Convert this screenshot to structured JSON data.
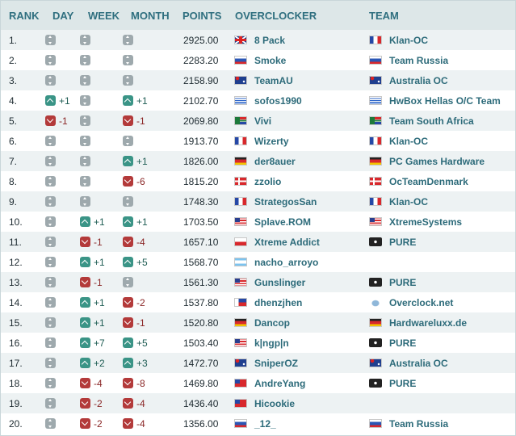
{
  "header": {
    "rank": "RANK",
    "day": "DAY",
    "week": "WEEK",
    "month": "MONTH",
    "points": "POINTS",
    "overclocker": "OVERCLOCKER",
    "team": "TEAM"
  },
  "rows": [
    {
      "rank": "1.",
      "day": {
        "dir": "same",
        "text": ""
      },
      "week": {
        "dir": "same",
        "text": ""
      },
      "month": {
        "dir": "same",
        "text": ""
      },
      "points": "2925.00",
      "overclocker": "8 Pack",
      "oc_flag": "uk",
      "team": "Klan-OC",
      "team_flag": "fr"
    },
    {
      "rank": "2.",
      "day": {
        "dir": "same",
        "text": ""
      },
      "week": {
        "dir": "same",
        "text": ""
      },
      "month": {
        "dir": "same",
        "text": ""
      },
      "points": "2283.20",
      "overclocker": "Smoke",
      "oc_flag": "ru",
      "team": "Team Russia",
      "team_flag": "ru"
    },
    {
      "rank": "3.",
      "day": {
        "dir": "same",
        "text": ""
      },
      "week": {
        "dir": "same",
        "text": ""
      },
      "month": {
        "dir": "same",
        "text": ""
      },
      "points": "2158.90",
      "overclocker": "TeamAU",
      "oc_flag": "au",
      "team": "Australia OC",
      "team_flag": "au"
    },
    {
      "rank": "4.",
      "day": {
        "dir": "up",
        "text": "+1"
      },
      "week": {
        "dir": "same",
        "text": ""
      },
      "month": {
        "dir": "up",
        "text": "+1"
      },
      "points": "2102.70",
      "overclocker": "sofos1990",
      "oc_flag": "gr",
      "team": "HwBox Hellas O/C Team",
      "team_flag": "gr"
    },
    {
      "rank": "5.",
      "day": {
        "dir": "down",
        "text": "-1"
      },
      "week": {
        "dir": "same",
        "text": ""
      },
      "month": {
        "dir": "down",
        "text": "-1"
      },
      "points": "2069.80",
      "overclocker": "Vivi",
      "oc_flag": "za",
      "team": "Team South Africa",
      "team_flag": "za"
    },
    {
      "rank": "6.",
      "day": {
        "dir": "same",
        "text": ""
      },
      "week": {
        "dir": "same",
        "text": ""
      },
      "month": {
        "dir": "same",
        "text": ""
      },
      "points": "1913.70",
      "overclocker": "Wizerty",
      "oc_flag": "fr",
      "team": "Klan-OC",
      "team_flag": "fr"
    },
    {
      "rank": "7.",
      "day": {
        "dir": "same",
        "text": ""
      },
      "week": {
        "dir": "same",
        "text": ""
      },
      "month": {
        "dir": "up",
        "text": "+1"
      },
      "points": "1826.00",
      "overclocker": "der8auer",
      "oc_flag": "de",
      "team": "PC Games Hardware",
      "team_flag": "de"
    },
    {
      "rank": "8.",
      "day": {
        "dir": "same",
        "text": ""
      },
      "week": {
        "dir": "same",
        "text": ""
      },
      "month": {
        "dir": "down",
        "text": "-6"
      },
      "points": "1815.20",
      "overclocker": "zzolio",
      "oc_flag": "dk",
      "team": "OcTeamDenmark",
      "team_flag": "dk"
    },
    {
      "rank": "9.",
      "day": {
        "dir": "same",
        "text": ""
      },
      "week": {
        "dir": "same",
        "text": ""
      },
      "month": {
        "dir": "same",
        "text": ""
      },
      "points": "1748.30",
      "overclocker": "StrategosSan",
      "oc_flag": "fr",
      "team": "Klan-OC",
      "team_flag": "fr"
    },
    {
      "rank": "10.",
      "day": {
        "dir": "same",
        "text": ""
      },
      "week": {
        "dir": "up",
        "text": "+1"
      },
      "month": {
        "dir": "up",
        "text": "+1"
      },
      "points": "1703.50",
      "overclocker": "Splave.ROM",
      "oc_flag": "us",
      "team": "XtremeSystems",
      "team_flag": "us"
    },
    {
      "rank": "11.",
      "day": {
        "dir": "same",
        "text": ""
      },
      "week": {
        "dir": "down",
        "text": "-1"
      },
      "month": {
        "dir": "down",
        "text": "-4"
      },
      "points": "1657.10",
      "overclocker": "Xtreme Addict",
      "oc_flag": "pl",
      "team": "PURE",
      "team_flag": "pure"
    },
    {
      "rank": "12.",
      "day": {
        "dir": "same",
        "text": ""
      },
      "week": {
        "dir": "up",
        "text": "+1"
      },
      "month": {
        "dir": "up",
        "text": "+5"
      },
      "points": "1568.70",
      "overclocker": "nacho_arroyo",
      "oc_flag": "ar",
      "team": "",
      "team_flag": "none"
    },
    {
      "rank": "13.",
      "day": {
        "dir": "same",
        "text": ""
      },
      "week": {
        "dir": "down",
        "text": "-1"
      },
      "month": {
        "dir": "same",
        "text": ""
      },
      "points": "1561.30",
      "overclocker": "Gunslinger",
      "oc_flag": "us",
      "team": "PURE",
      "team_flag": "pure"
    },
    {
      "rank": "14.",
      "day": {
        "dir": "same",
        "text": ""
      },
      "week": {
        "dir": "up",
        "text": "+1"
      },
      "month": {
        "dir": "down",
        "text": "-2"
      },
      "points": "1537.80",
      "overclocker": "dhenzjhen",
      "oc_flag": "ph",
      "team": "Overclock.net",
      "team_flag": "ocnet"
    },
    {
      "rank": "15.",
      "day": {
        "dir": "same",
        "text": ""
      },
      "week": {
        "dir": "up",
        "text": "+1"
      },
      "month": {
        "dir": "down",
        "text": "-1"
      },
      "points": "1520.80",
      "overclocker": "Dancop",
      "oc_flag": "de",
      "team": "Hardwareluxx.de",
      "team_flag": "de"
    },
    {
      "rank": "16.",
      "day": {
        "dir": "same",
        "text": ""
      },
      "week": {
        "dir": "up",
        "text": "+7"
      },
      "month": {
        "dir": "up",
        "text": "+5"
      },
      "points": "1503.40",
      "overclocker": "k|ngp|n",
      "oc_flag": "us",
      "team": "PURE",
      "team_flag": "pure"
    },
    {
      "rank": "17.",
      "day": {
        "dir": "same",
        "text": ""
      },
      "week": {
        "dir": "up",
        "text": "+2"
      },
      "month": {
        "dir": "up",
        "text": "+3"
      },
      "points": "1472.70",
      "overclocker": "SniperOZ",
      "oc_flag": "au",
      "team": "Australia OC",
      "team_flag": "au"
    },
    {
      "rank": "18.",
      "day": {
        "dir": "same",
        "text": ""
      },
      "week": {
        "dir": "down",
        "text": "-4"
      },
      "month": {
        "dir": "down",
        "text": "-8"
      },
      "points": "1469.80",
      "overclocker": "AndreYang",
      "oc_flag": "tw",
      "team": "PURE",
      "team_flag": "pure"
    },
    {
      "rank": "19.",
      "day": {
        "dir": "same",
        "text": ""
      },
      "week": {
        "dir": "down",
        "text": "-2"
      },
      "month": {
        "dir": "down",
        "text": "-4"
      },
      "points": "1436.40",
      "overclocker": "Hicookie",
      "oc_flag": "tw",
      "team": "",
      "team_flag": "none"
    },
    {
      "rank": "20.",
      "day": {
        "dir": "same",
        "text": ""
      },
      "week": {
        "dir": "down",
        "text": "-2"
      },
      "month": {
        "dir": "down",
        "text": "-4"
      },
      "points": "1356.00",
      "overclocker": "_12_",
      "oc_flag": "ru",
      "team": "Team Russia",
      "team_flag": "ru"
    }
  ],
  "colors": {
    "header_bg": "#dde7e8",
    "header_text": "#2f6f7f",
    "row_alt_bg": "#edf2f3",
    "link": "#2d6b7a",
    "up": "#3a9486",
    "down": "#b33a3a",
    "same": "#9ea9ad"
  }
}
